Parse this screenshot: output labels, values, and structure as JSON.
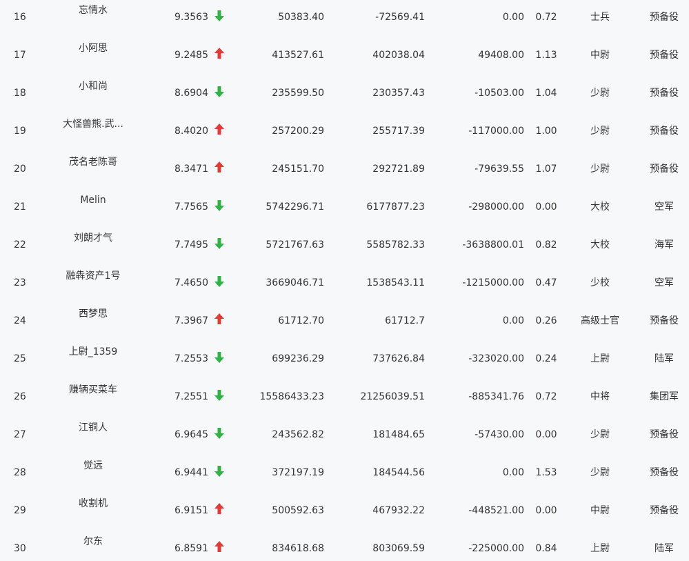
{
  "colors": {
    "up": "#e53935",
    "down": "#2fb344",
    "background": "#f6f8fa",
    "text": "#333333"
  },
  "rows": [
    {
      "rank": "16",
      "name": "忘情水",
      "score": "9.3563",
      "trend": "down",
      "v1": "50383.40",
      "v2": "-72569.41",
      "v3": "0.00",
      "ratio": "0.72",
      "title": "士兵",
      "branch": "预备役"
    },
    {
      "rank": "17",
      "name": "小阿思",
      "score": "9.2485",
      "trend": "up",
      "v1": "413527.61",
      "v2": "402038.04",
      "v3": "49408.00",
      "ratio": "1.13",
      "title": "中尉",
      "branch": "预备役"
    },
    {
      "rank": "18",
      "name": "小和尚",
      "score": "8.6904",
      "trend": "down",
      "v1": "235599.50",
      "v2": "230357.43",
      "v3": "-10503.00",
      "ratio": "1.04",
      "title": "少尉",
      "branch": "预备役"
    },
    {
      "rank": "19",
      "name": "大怪兽熊.武...",
      "score": "8.4020",
      "trend": "up",
      "v1": "257200.29",
      "v2": "255717.39",
      "v3": "-117000.00",
      "ratio": "1.00",
      "title": "少尉",
      "branch": "预备役"
    },
    {
      "rank": "20",
      "name": "茂名老陈哥",
      "score": "8.3471",
      "trend": "up",
      "v1": "245151.70",
      "v2": "292721.89",
      "v3": "-79639.55",
      "ratio": "1.07",
      "title": "少尉",
      "branch": "预备役"
    },
    {
      "rank": "21",
      "name": "Melin",
      "score": "7.7565",
      "trend": "down",
      "v1": "5742296.71",
      "v2": "6177877.23",
      "v3": "-298000.00",
      "ratio": "0.00",
      "title": "大校",
      "branch": "空军"
    },
    {
      "rank": "22",
      "name": "刘朗才气",
      "score": "7.7495",
      "trend": "down",
      "v1": "5721767.63",
      "v2": "5585782.33",
      "v3": "-3638800.01",
      "ratio": "0.82",
      "title": "大校",
      "branch": "海军"
    },
    {
      "rank": "23",
      "name": "融犇资产1号",
      "score": "7.4650",
      "trend": "down",
      "v1": "3669046.71",
      "v2": "1538543.11",
      "v3": "-1215000.00",
      "ratio": "0.47",
      "title": "少校",
      "branch": "空军"
    },
    {
      "rank": "24",
      "name": "西梦思",
      "score": "7.3967",
      "trend": "up",
      "v1": "61712.70",
      "v2": "61712.7",
      "v3": "0.00",
      "ratio": "0.26",
      "title": "高级士官",
      "branch": "预备役"
    },
    {
      "rank": "25",
      "name": "上尉_1359",
      "score": "7.2553",
      "trend": "down",
      "v1": "699236.29",
      "v2": "737626.84",
      "v3": "-323020.00",
      "ratio": "0.24",
      "title": "上尉",
      "branch": "陆军"
    },
    {
      "rank": "26",
      "name": "赚辆买菜车",
      "score": "7.2551",
      "trend": "down",
      "v1": "15586433.23",
      "v2": "21256039.51",
      "v3": "-885341.76",
      "ratio": "0.72",
      "title": "中将",
      "branch": "集团军"
    },
    {
      "rank": "27",
      "name": "江铜人",
      "score": "6.9645",
      "trend": "down",
      "v1": "243562.82",
      "v2": "181484.65",
      "v3": "-57430.00",
      "ratio": "0.00",
      "title": "少尉",
      "branch": "预备役"
    },
    {
      "rank": "28",
      "name": "觉远",
      "score": "6.9441",
      "trend": "down",
      "v1": "372197.19",
      "v2": "184544.56",
      "v3": "0.00",
      "ratio": "1.53",
      "title": "少尉",
      "branch": "预备役"
    },
    {
      "rank": "29",
      "name": "收割机",
      "score": "6.9151",
      "trend": "up",
      "v1": "500592.63",
      "v2": "467932.22",
      "v3": "-448521.00",
      "ratio": "0.00",
      "title": "中尉",
      "branch": "预备役"
    },
    {
      "rank": "30",
      "name": "尔东",
      "score": "6.8591",
      "trend": "up",
      "v1": "834618.68",
      "v2": "803069.59",
      "v3": "-225000.00",
      "ratio": "0.84",
      "title": "上尉",
      "branch": "陆军"
    }
  ]
}
